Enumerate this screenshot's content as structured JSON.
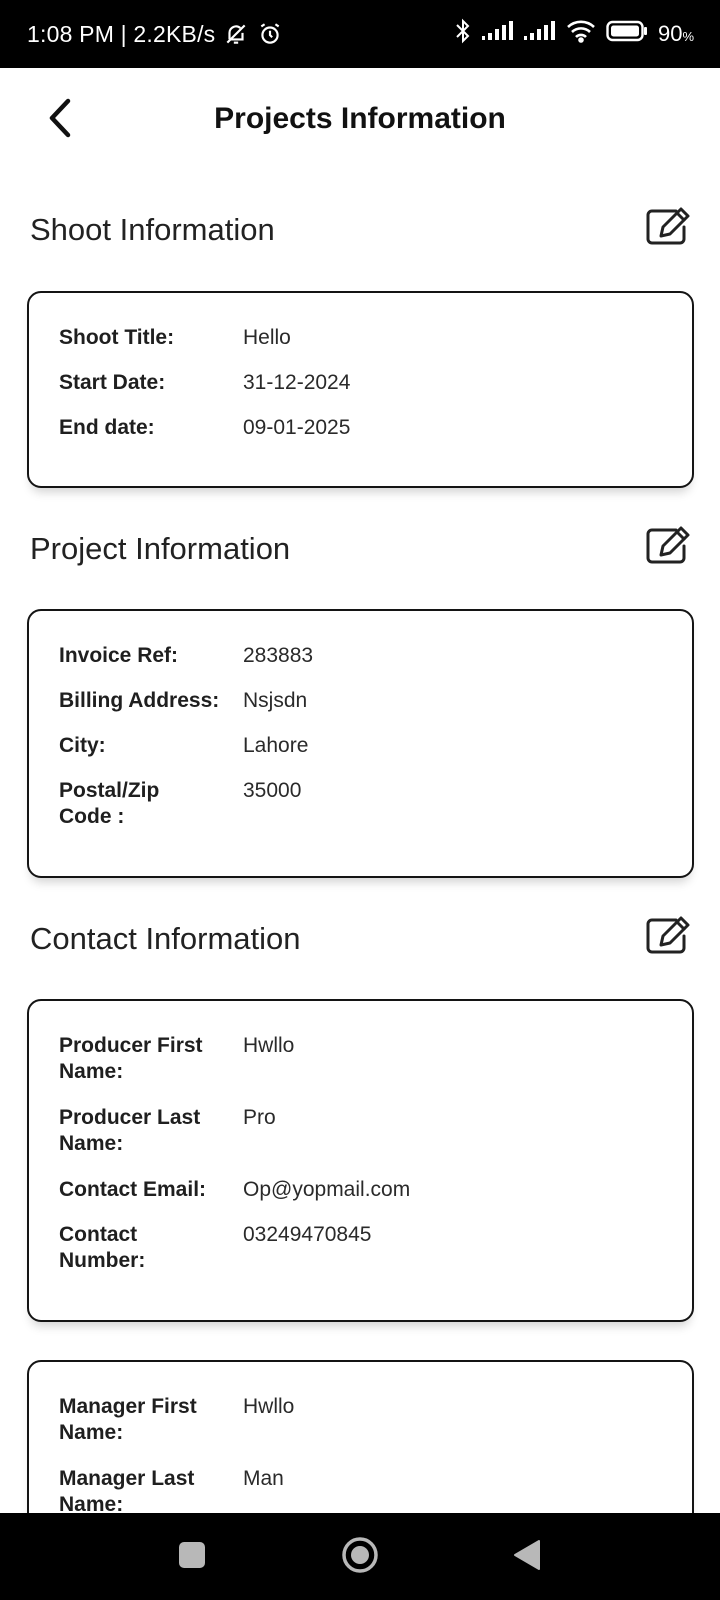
{
  "status_bar": {
    "left_text": "1:08 PM | 2.2KB/s",
    "battery_text": "90",
    "battery_unit": "%"
  },
  "header": {
    "title": "Projects Information"
  },
  "shoot": {
    "title": "Shoot Information",
    "rows": [
      {
        "label": "Shoot Title:",
        "value": "Hello"
      },
      {
        "label": "Start Date:",
        "value": "31-12-2024"
      },
      {
        "label": "End date:",
        "value": "09-01-2025"
      }
    ]
  },
  "project": {
    "title": "Project Information",
    "rows": [
      {
        "label": "Invoice Ref:",
        "value": "283883"
      },
      {
        "label": "Billing Address:",
        "value": "Nsjsdn"
      },
      {
        "label": "City:",
        "value": "Lahore"
      },
      {
        "label": "Postal/Zip Code :",
        "value": "35000"
      }
    ]
  },
  "contact": {
    "title": "Contact Information",
    "producer_rows": [
      {
        "label": "Producer First Name:",
        "value": "Hwllo"
      },
      {
        "label": "Producer Last Name:",
        "value": "Pro"
      },
      {
        "label": "Contact Email:",
        "value": "Op@yopmail.com"
      },
      {
        "label": "Contact Number:",
        "value": "03249470845"
      }
    ],
    "manager_rows": [
      {
        "label": "Manager First Name:",
        "value": "Hwllo"
      },
      {
        "label": "Manager Last Name:",
        "value": "Man"
      }
    ]
  },
  "icons": {
    "back": "chevron-left-icon",
    "edit": "edit-icon",
    "nav_recent": "square-icon",
    "nav_home": "circle-icon",
    "nav_back": "triangle-back-icon"
  }
}
